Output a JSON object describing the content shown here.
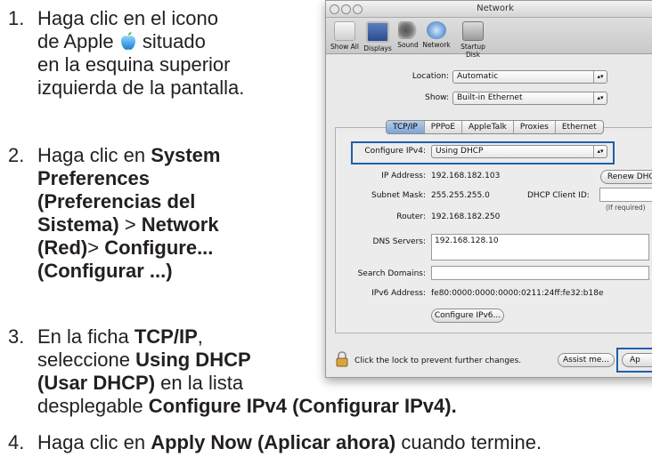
{
  "instructions": {
    "step1": {
      "num": "1.",
      "l1": "Haga clic en el icono",
      "l2a": "de Apple",
      "l2b": "situado",
      "l3": "en la esquina superior",
      "l4": "izquierda de la pantalla."
    },
    "step2": {
      "num": "2.",
      "l1a": "Haga clic en ",
      "l1b": "System",
      "l2": "Preferences",
      "l3": "(Preferencias del",
      "l4a": "Sistema)",
      "l4b": " > ",
      "l4c": "Network",
      "l5a": "(Red)",
      "l5b": "> ",
      "l5c": "Configure...",
      "l6": "(Configurar ...)"
    },
    "step3": {
      "num": "3.",
      "l1a": "En la ficha ",
      "l1b": "TCP/IP",
      "l1c": ",",
      "l2a": "seleccione ",
      "l2b": "Using DHCP",
      "l3a": "(Usar DHCP)",
      "l3b": " en la lista",
      "l4a": "desplegable ",
      "l4b": "Configure IPv4 (Configurar IPv4)."
    },
    "step4": {
      "num": "4.",
      "a": "Haga clic en ",
      "b": "Apply Now (Aplicar ahora)",
      "c": " cuando termine."
    }
  },
  "window": {
    "title": "Network",
    "toolbar": [
      "Show All",
      "Displays",
      "Sound",
      "Network",
      "Startup Disk"
    ],
    "location_label": "Location:",
    "location_value": "Automatic",
    "show_label": "Show:",
    "show_value": "Built-in Ethernet",
    "tabs": [
      "TCP/IP",
      "PPPoE",
      "AppleTalk",
      "Proxies",
      "Ethernet"
    ],
    "configure_label": "Configure IPv4:",
    "configure_value": "Using DHCP",
    "ip_label": "IP Address:",
    "ip_value": "192.168.182.103",
    "renew_button": "Renew DHCP",
    "subnet_label": "Subnet Mask:",
    "subnet_value": "255.255.255.0",
    "client_id_label": "DHCP Client ID:",
    "if_required": "(If required)",
    "router_label": "Router:",
    "router_value": "192.168.182.250",
    "dns_label": "DNS Servers:",
    "dns_value": "192.168.128.10",
    "search_label": "Search Domains:",
    "ipv6_label": "IPv6 Address:",
    "ipv6_value": "fe80:0000:0000:0000:0211:24ff:fe32:b18e",
    "configure_ipv6_button": "Configure IPv6...",
    "lock_text": "Click the lock to prevent further changes.",
    "assist_button": "Assist me...",
    "apply_button": "Ap"
  }
}
